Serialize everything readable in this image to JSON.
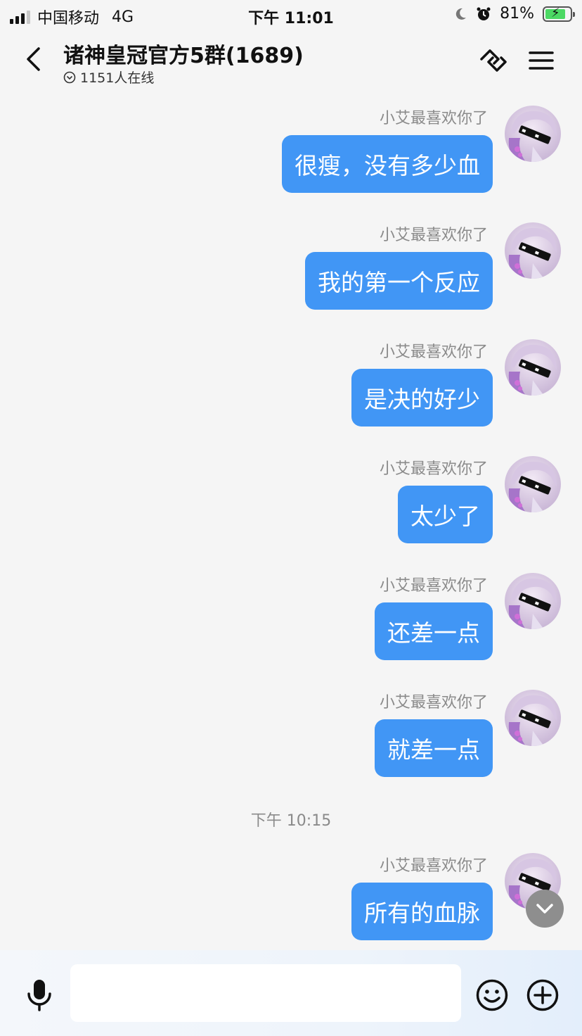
{
  "status_bar": {
    "carrier": "中国移动",
    "network": "4G",
    "time": "下午 11:01",
    "battery": "81%",
    "battery_level": 0.81
  },
  "header": {
    "title": "诸神皇冠官方5群(1689)",
    "online": "1151人在线"
  },
  "messages": [
    {
      "sender": "小艾最喜欢你了",
      "text": "很瘦，没有多少血"
    },
    {
      "sender": "小艾最喜欢你了",
      "text": "我的第一个反应"
    },
    {
      "sender": "小艾最喜欢你了",
      "text": "是决的好少"
    },
    {
      "sender": "小艾最喜欢你了",
      "text": "太少了"
    },
    {
      "sender": "小艾最喜欢你了",
      "text": "还差一点"
    },
    {
      "sender": "小艾最喜欢你了",
      "text": "就差一点"
    },
    {
      "sender": "小艾最喜欢你了",
      "text": "所有的血脉"
    }
  ],
  "time_separator": "下午 10:15",
  "input": {
    "value": "",
    "placeholder": ""
  },
  "colors": {
    "bubble": "#4196f5",
    "background": "#f5f5f5",
    "sender": "#8a8a8a"
  },
  "icons": {
    "back": "chevron-left-icon",
    "link": "link-icon",
    "menu": "menu-icon",
    "mic": "mic-icon",
    "emoji": "smiley-icon",
    "add": "plus-circle-icon",
    "scroll": "chevron-down-icon"
  }
}
